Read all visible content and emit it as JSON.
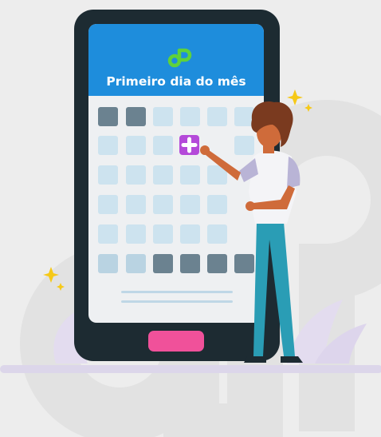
{
  "screen": {
    "title": "Primeiro dia do mês"
  },
  "icons": {
    "logo": "dp-logo-icon",
    "plus": "plus-icon",
    "sparkle": "sparkle-icon"
  },
  "colors": {
    "background": "#ededed",
    "phone_body": "#1d2b32",
    "screen_header": "#1e8ddc",
    "logo_green": "#5fd23a",
    "accent_pink": "#f0519a",
    "plus_tile": "#b44ad9",
    "calendar_cell": "#cde3ef",
    "calendar_cell_dark": "#6b8290",
    "sparkle": "#f6c918"
  }
}
